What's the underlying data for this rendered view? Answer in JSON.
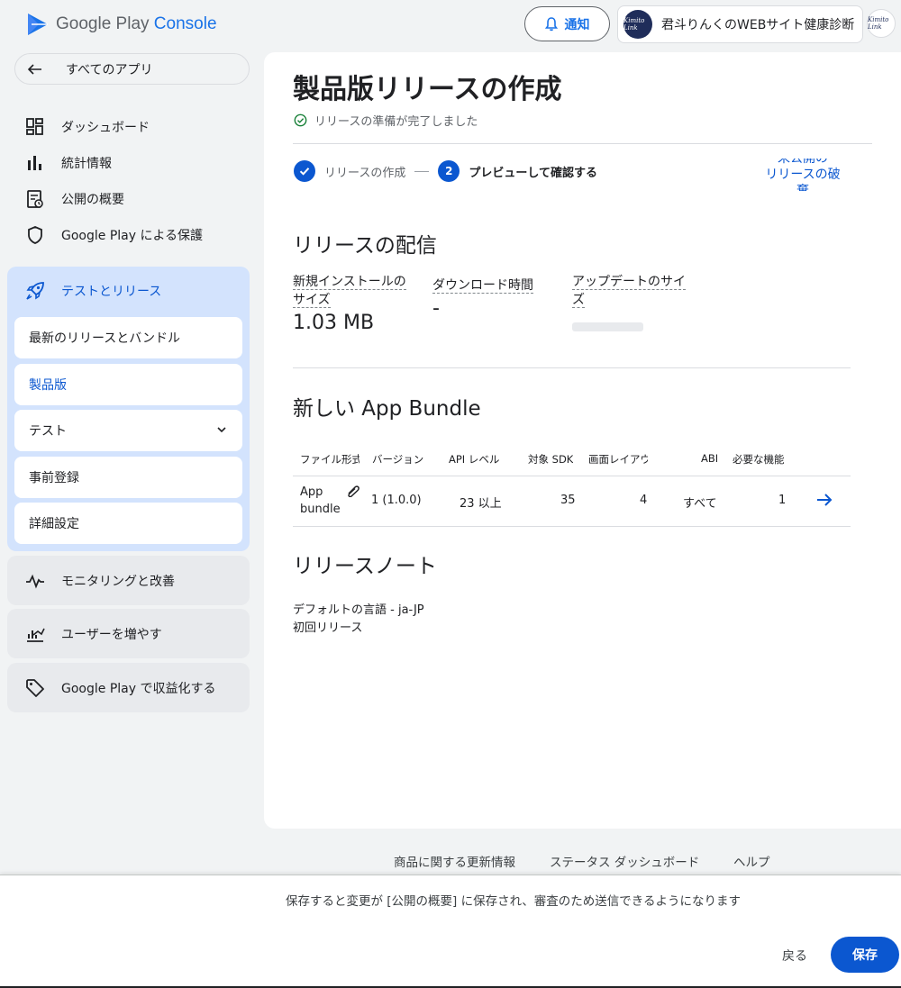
{
  "header": {
    "logo_part1": "Google Play",
    "logo_part2": "Console",
    "notify_label": "通知",
    "account_name": "君斗りんくのWEBサイト健康診断",
    "avatar_text": "Kimito Link"
  },
  "sidebar": {
    "all_apps": "すべてのアプリ",
    "items": [
      {
        "label": "ダッシュボード",
        "icon": "dashboard-icon"
      },
      {
        "label": "統計情報",
        "icon": "bar-chart-icon"
      },
      {
        "label": "公開の概要",
        "icon": "publish-overview-icon"
      },
      {
        "label": "Google Play による保護",
        "icon": "shield-icon"
      }
    ],
    "test_release": {
      "label": "テストとリリース",
      "icon": "rocket-icon",
      "sub_items": [
        "最新のリリースとバンドル",
        "製品版",
        "テスト",
        "事前登録",
        "詳細設定"
      ]
    },
    "groups": [
      {
        "label": "モニタリングと改善",
        "icon": "monitoring-icon"
      },
      {
        "label": "ユーザーを増やす",
        "icon": "grow-users-icon"
      },
      {
        "label": "Google Play で収益化する",
        "icon": "tag-icon"
      }
    ]
  },
  "main": {
    "title": "製品版リリースの作成",
    "ready_text": "リリースの準備が完了しました",
    "steps": [
      "リリースの作成",
      "プレビューして確認する"
    ],
    "step2_number": "2",
    "discard_link_lines": [
      "未公開の",
      "リリースの破",
      "棄"
    ],
    "delivery": {
      "title": "リリースの配信",
      "install_size_label_lines": [
        "新規インストールの",
        "サイズ"
      ],
      "install_size_value": "1.03 MB",
      "download_time_label": "ダウンロード時間",
      "download_time_value": "-",
      "update_size_label_lines": [
        "アップデートのサイ",
        "ズ"
      ]
    },
    "bundle": {
      "title": "新しい App Bundle",
      "columns": [
        "ファイル形式",
        "バージョン",
        "API レベル",
        "対象 SDK",
        "画面レイアウト",
        "ABI",
        "必要な機能"
      ],
      "row": {
        "file_type_lines": [
          "App",
          "bundle"
        ],
        "version": "1 (1.0.0)",
        "api_level": "23 以上",
        "target_sdk": "35",
        "screen_layouts": "4",
        "abi": "すべて",
        "features": "1"
      }
    },
    "notes": {
      "title": "リリースノート",
      "language": "デフォルトの言語 - ja-JP",
      "text": "初回リリース"
    }
  },
  "footer": {
    "links": [
      "商品に関する更新情報",
      "ステータス ダッシュボード",
      "ヘルプ"
    ]
  },
  "bottom_bar": {
    "message": "保存すると変更が [公開の概要] に保存され、審査のため送信できるようになります",
    "back_label": "戻る",
    "save_label": "保存"
  }
}
